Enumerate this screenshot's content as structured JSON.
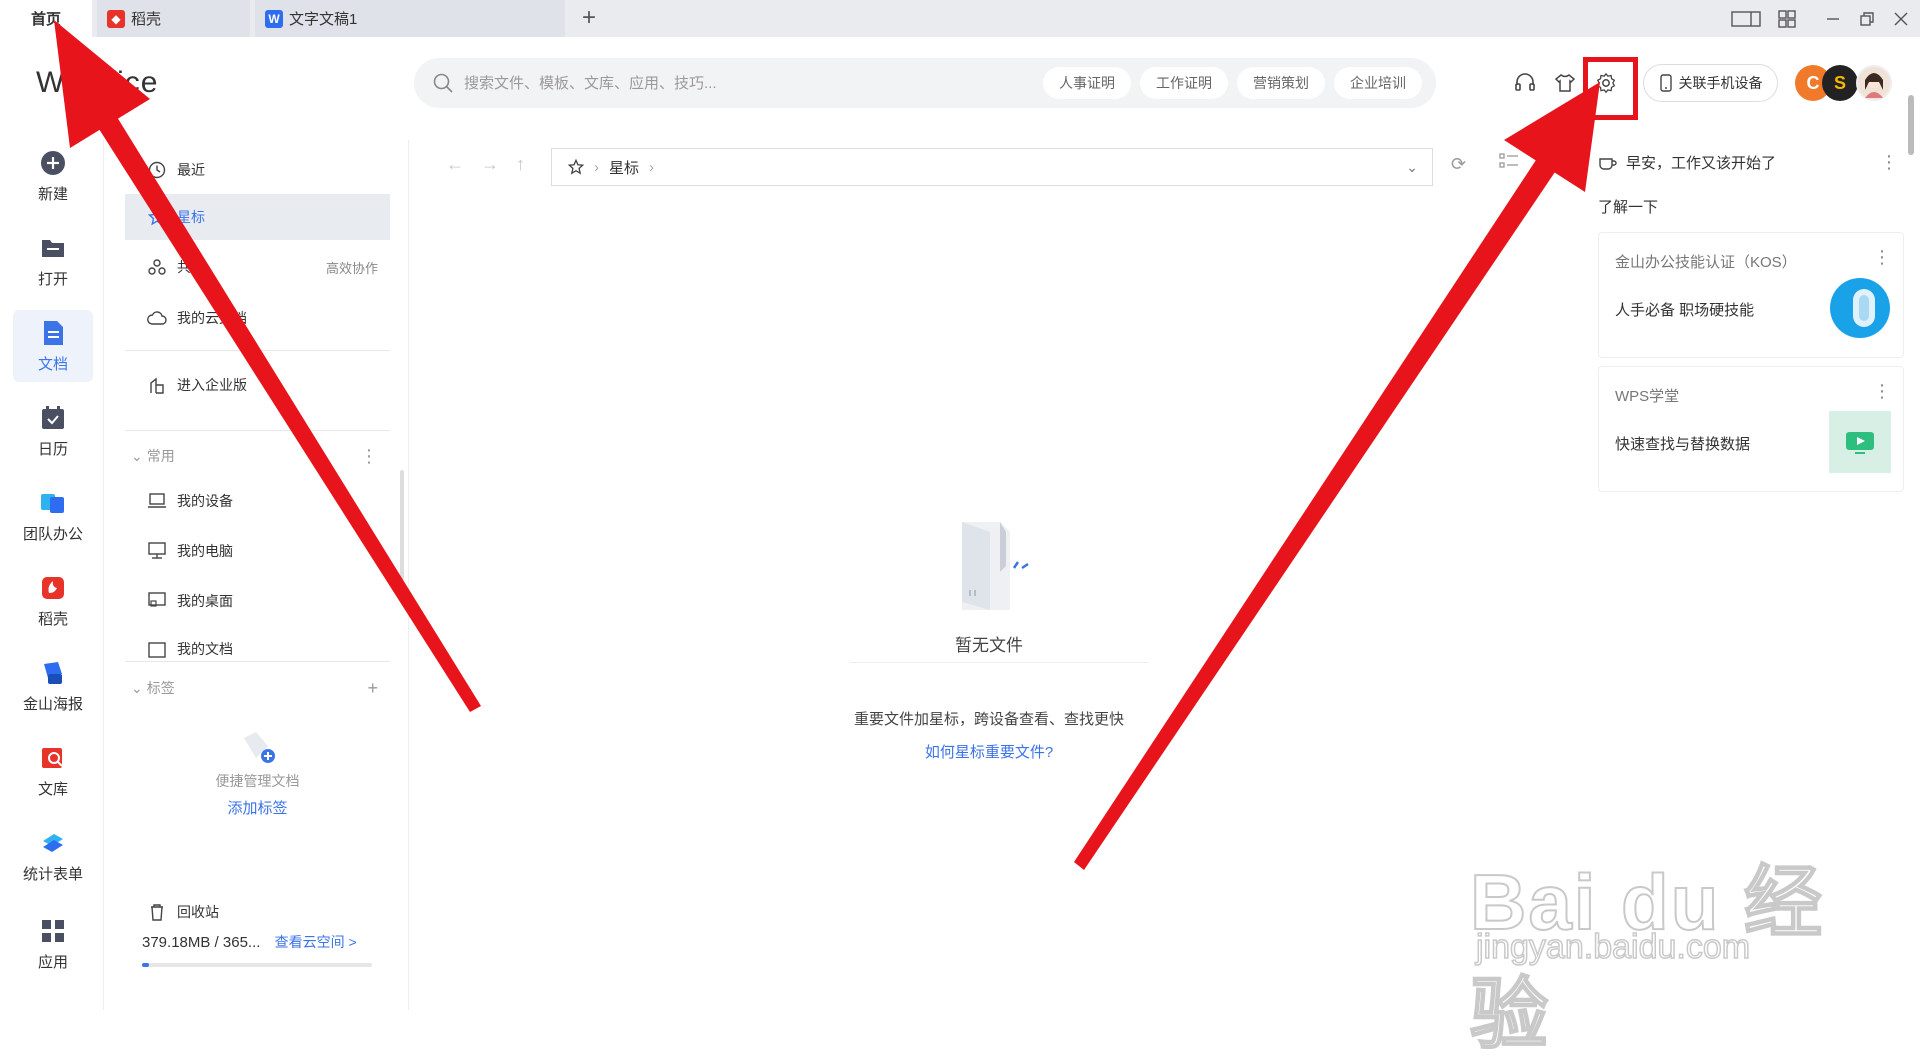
{
  "tabs": [
    {
      "label": "首页"
    },
    {
      "label": "稻壳"
    },
    {
      "label": "文字文稿1"
    }
  ],
  "tab_add": "+",
  "window_controls": [
    "1⃣",
    "▦",
    "—",
    "❐",
    "✕"
  ],
  "header": {
    "logo": "W   Office",
    "search_placeholder": "搜索文件、模板、文库、应用、技巧...",
    "chips": [
      "人事证明",
      "工作证明",
      "营销策划",
      "企业培训"
    ],
    "phone_button": "关联手机设备"
  },
  "leftnav": [
    {
      "label": "新建",
      "icon": "plus-circle-icon"
    },
    {
      "label": "打开",
      "icon": "folder-icon"
    },
    {
      "label": "文档",
      "icon": "document-icon",
      "active": true
    },
    {
      "label": "日历",
      "icon": "calendar-icon"
    },
    {
      "label": "团队办公",
      "icon": "team-icon"
    },
    {
      "label": "稻壳",
      "icon": "docer-icon"
    },
    {
      "label": "金山海报",
      "icon": "poster-icon"
    },
    {
      "label": "文库",
      "icon": "library-icon"
    },
    {
      "label": "统计表单",
      "icon": "form-icon"
    },
    {
      "label": "应用",
      "icon": "apps-icon"
    }
  ],
  "panel": {
    "recent": "最近",
    "starred": "星标",
    "shared": "共享",
    "shared_extra": "高效协作",
    "cloud": "我的云文档",
    "enterprise": "进入企业版",
    "common_title": "常用",
    "common": [
      "我的设备",
      "我的电脑",
      "我的桌面",
      "我的文档"
    ],
    "tags_title": "标签",
    "tags_empty": "便捷管理文档",
    "tags_add": "添加标签",
    "recycle": "回收站",
    "storage": "379.18MB / 365...",
    "storage_link": "查看云空间 >",
    "storage_used": 0.02
  },
  "main": {
    "breadcrumb": "星标",
    "empty_title": "暂无文件",
    "empty_desc": "重要文件加星标，跨设备查看、查找更快",
    "empty_link": "如何星标重要文件?"
  },
  "right": {
    "greeting": "早安，工作又该开始了",
    "learn": "了解一下",
    "cards": [
      {
        "title": "金山办公技能认证（KOS）",
        "desc": "人手必备 职场硬技能"
      },
      {
        "title": "WPS学堂",
        "desc": "快速查找与替换数据"
      }
    ]
  },
  "watermark": {
    "brand": "Bai du 经验",
    "url": "jingyan.baidu.com"
  },
  "colors": {
    "accent": "#3b73e8",
    "annotation": "#e8141c"
  }
}
